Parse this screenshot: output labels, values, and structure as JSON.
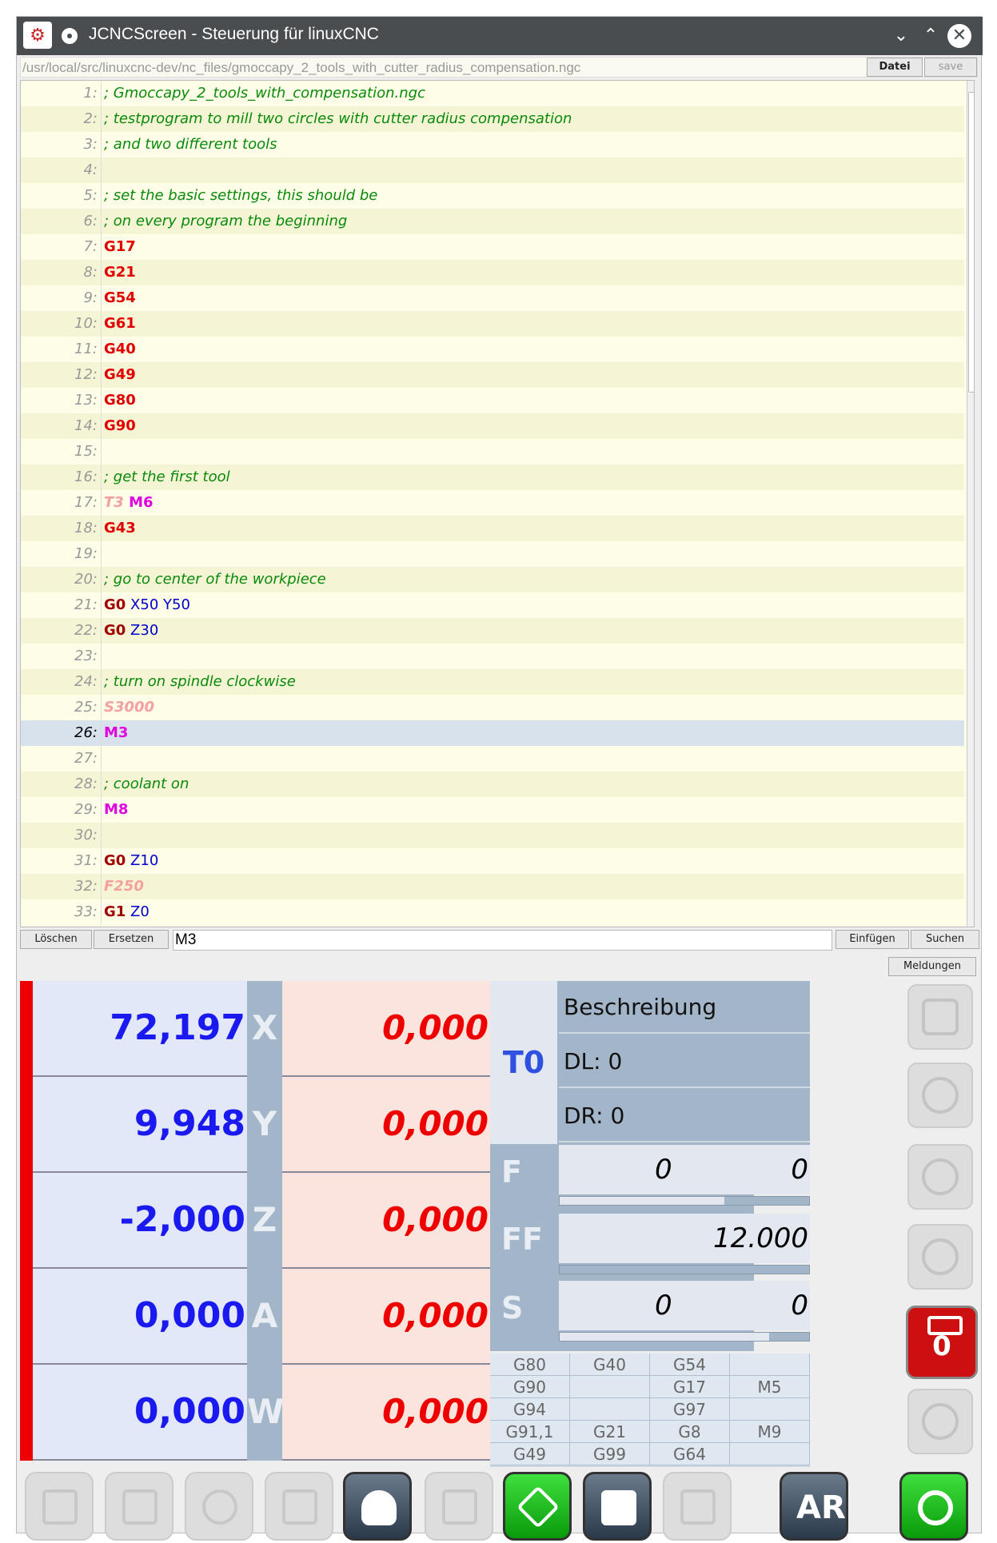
{
  "window": {
    "title": "JCNCScreen - Steuerung für linuxCNC",
    "file_path": "/usr/local/src/linuxcnc-dev/nc_files/gmoccapy_2_tools_with_cutter_radius_compensation.ngc",
    "btn_datei": "Datei",
    "btn_save": "save"
  },
  "editor": {
    "lines": [
      {
        "n": "1:",
        "t": "; Gmoccapy_2_tools_with_compensation.ngc"
      },
      {
        "n": "2:",
        "t": "; testprogram to mill two circles with cutter radius compensation"
      },
      {
        "n": "3:",
        "t": "; and two different tools"
      },
      {
        "n": "4:",
        "t": ""
      },
      {
        "n": "5:",
        "t": "; set the basic settings, this should be"
      },
      {
        "n": "6:",
        "t": "; on every program the beginning"
      },
      {
        "n": "7:",
        "t": "G17"
      },
      {
        "n": "8:",
        "t": "G21"
      },
      {
        "n": "9:",
        "t": "G54"
      },
      {
        "n": "10:",
        "t": "G61"
      },
      {
        "n": "11:",
        "t": "G40"
      },
      {
        "n": "12:",
        "t": "G49"
      },
      {
        "n": "13:",
        "t": "G80"
      },
      {
        "n": "14:",
        "t": "G90"
      },
      {
        "n": "15:",
        "t": ""
      },
      {
        "n": "16:",
        "t": "; get the first tool"
      },
      {
        "n": "17:",
        "t1": "T3",
        "t2": " M6"
      },
      {
        "n": "18:",
        "t": "G43"
      },
      {
        "n": "19:",
        "t": ""
      },
      {
        "n": "20:",
        "t": "; go to center of the workpiece"
      },
      {
        "n": "21:",
        "t1": "G0",
        "t2": " X50 Y50"
      },
      {
        "n": "22:",
        "t1": "G0",
        "t2": " Z30"
      },
      {
        "n": "23:",
        "t": ""
      },
      {
        "n": "24:",
        "t": "; turn on spindle clockwise"
      },
      {
        "n": "25:",
        "t": "S3000"
      },
      {
        "n": "26:",
        "t": "M3"
      },
      {
        "n": "27:",
        "t": ""
      },
      {
        "n": "28:",
        "t": "; coolant on"
      },
      {
        "n": "29:",
        "t": "M8"
      },
      {
        "n": "30:",
        "t": ""
      },
      {
        "n": "31:",
        "t1": "G0",
        "t2": " Z10"
      },
      {
        "n": "32:",
        "t": "F250"
      },
      {
        "n": "33:",
        "t1": "G1",
        "t2": " Z0"
      }
    ]
  },
  "findbar": {
    "btn_loeschen": "Löschen",
    "btn_ersetzen": "Ersetzen",
    "input_value": "M3",
    "btn_einfuegen": "Einfügen",
    "btn_suchen": "Suchen",
    "btn_meldungen": "Meldungen"
  },
  "dro": [
    {
      "axis": "X",
      "value": "72,197",
      "dtg": "0,000"
    },
    {
      "axis": "Y",
      "value": "9,948",
      "dtg": "0,000"
    },
    {
      "axis": "Z",
      "value": "-2,000",
      "dtg": "0,000"
    },
    {
      "axis": "A",
      "value": "0,000",
      "dtg": "0,000"
    },
    {
      "axis": "W",
      "value": "0,000",
      "dtg": "0,000"
    }
  ],
  "tool": {
    "number": "T0",
    "description": "Beschreibung",
    "dl": "DL: 0",
    "dr": "DR: 0"
  },
  "feed": {
    "f_label": "F",
    "f_val1": "0",
    "f_val2": "0",
    "f_override": 0.66,
    "ff_label": "FF",
    "ff_val": "12.000",
    "s_label": "S",
    "s_val1": "0",
    "s_val2": "0",
    "s_override": 0.84
  },
  "gcodes": [
    [
      "G80",
      "G40",
      "G54",
      ""
    ],
    [
      "G90",
      "",
      "G17",
      "M5"
    ],
    [
      "G94",
      "",
      "G97",
      ""
    ],
    [
      "G91,1",
      "G21",
      "G8",
      "M9"
    ],
    [
      "G49",
      "G99",
      "G64",
      ""
    ]
  ],
  "spindle_stop": {
    "value": "0"
  },
  "colors": {
    "dro_value": "#1a1af0",
    "dtg_value": "#ee0000",
    "axis_label_bg": "#a3b6c9",
    "active_button_green": "#1fbf1f"
  },
  "icons": {
    "bottom": [
      "step-icon",
      "pause-icon",
      "record-icon",
      "forward-icon",
      "hand-jog-icon",
      "document-icon",
      "run-program-icon",
      "edit-program-icon",
      "tool-change-icon",
      "ar-icon",
      "power-icon"
    ],
    "right": [
      "document-icon",
      "coolant-flood-icon",
      "coolant-mist-icon",
      "spindle-cw-icon",
      "spindle-stop-icon",
      "spindle-ccw-icon"
    ]
  }
}
